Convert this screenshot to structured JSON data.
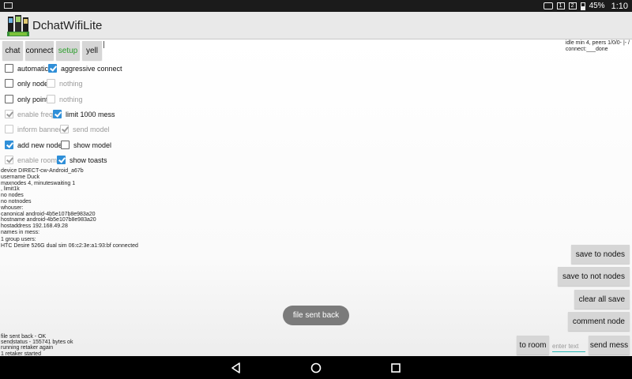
{
  "status_bar": {
    "battery": "45%",
    "time": "1:10"
  },
  "app_bar": {
    "title": "DchatWifiLite"
  },
  "top_buttons": [
    {
      "label": "chat"
    },
    {
      "label": "connect"
    },
    {
      "label": "setup",
      "active": true
    },
    {
      "label": "yell"
    }
  ],
  "idle_status": {
    "line1": "idle min 4, peers 1/0/0- |- /",
    "line2": "connect:___done"
  },
  "options": {
    "automatic": "automatic",
    "aggressive_connect": "aggressive connect",
    "only_node": "only node",
    "nothing_1": "nothing",
    "only_point": "only point",
    "nothing_2": "nothing",
    "enable_freqs": "enable freqs",
    "limit_1000": "limit 1000 mess",
    "inform_banned": "inform banned",
    "send_model": "send model",
    "add_new_nodes": "add new nodes",
    "show_model": "show model",
    "enable_rooms": "enable rooms",
    "show_toasts": "show toasts"
  },
  "info_lines": [
    "device DIRECT-cw-Android_a67b",
    "username Duck",
    "maxnodes 4, minuteswaiting 1",
    ", limit1k",
    "no nodes",
    "no notnodes",
    "whouser:",
    "canonical android-4b5e107b8e983a20",
    "hostname android-4b5e107b8e983a20",
    "hostaddress 192.168.49.28",
    "names in mess:",
    "",
    "1 group users:",
    "HTC Desire 526G dual sim 06:c2:3e:a1:93:bf connected"
  ],
  "right_buttons": {
    "save_to_nodes": "save to nodes",
    "save_to_not_nodes": "save to not nodes",
    "clear_all_save": "clear all save",
    "comment_node": "comment node"
  },
  "toast": "file sent back",
  "log_lines": [
    "file sent back - OK",
    "sendstatus - 155741 bytes ok",
    "running retaker again",
    "1 retaker started"
  ],
  "bottom": {
    "to_room": "to room",
    "enter_placeholder": "enter text",
    "send_mess": "send mess"
  }
}
